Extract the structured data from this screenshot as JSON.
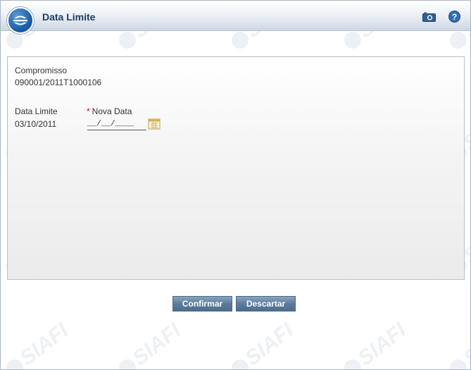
{
  "header": {
    "title": "Data Limite",
    "icons": {
      "logo": "siafi-logo",
      "camera": "camera-icon",
      "help": "help-icon"
    },
    "help_glyph": "?"
  },
  "form": {
    "compromisso_label": "Compromisso",
    "compromisso_value": "090001/2011T1000106",
    "data_limite_label": "Data Limite",
    "data_limite_value": "03/10/2011",
    "nova_data_required_mark": "*",
    "nova_data_label": "Nova Data",
    "nova_data_value": "__/__/____"
  },
  "buttons": {
    "confirm_label": "Confirmar",
    "discard_label": "Descartar"
  },
  "watermark": {
    "text": "SIAFI"
  },
  "colors": {
    "header_title": "#1f3b5e",
    "button_bg": "#5d7c9b",
    "required_mark": "#cc0000",
    "watermark": "#dfe7ee"
  }
}
